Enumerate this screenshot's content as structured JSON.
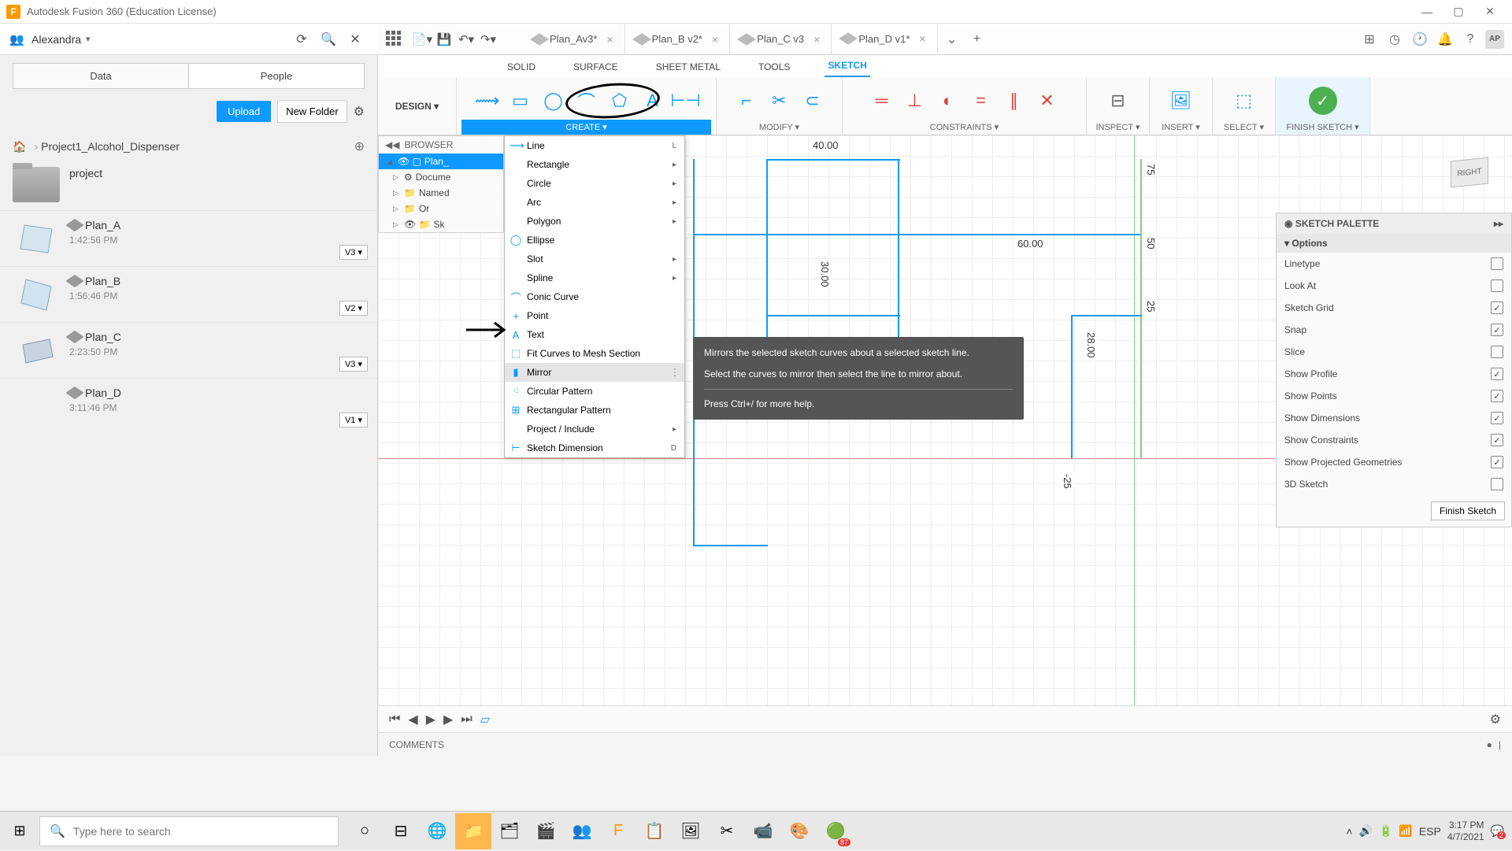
{
  "window": {
    "title": "Autodesk Fusion 360 (Education License)"
  },
  "user": {
    "name": "Alexandra",
    "avatar": "AP"
  },
  "datapanel": {
    "tabs": [
      "Data",
      "People"
    ],
    "upload": "Upload",
    "newfolder": "New Folder",
    "project": "Project1_Alcohol_Dispenser",
    "folder": "project",
    "items": [
      {
        "name": "Plan_A",
        "time": "1:42:56 PM",
        "ver": "V3 ▾"
      },
      {
        "name": "Plan_B",
        "time": "1:56:46 PM",
        "ver": "V2 ▾"
      },
      {
        "name": "Plan_C",
        "time": "2:23:50 PM",
        "ver": "V3 ▾"
      },
      {
        "name": "Plan_D",
        "time": "3:11:46 PM",
        "ver": "V1 ▾"
      }
    ]
  },
  "filetabs": [
    {
      "label": "Plan_Av3*"
    },
    {
      "label": "Plan_B v2*"
    },
    {
      "label": "Plan_C v3"
    },
    {
      "label": "Plan_D v1*"
    }
  ],
  "workspaces": {
    "items": [
      "SOLID",
      "SURFACE",
      "SHEET METAL",
      "TOOLS",
      "SKETCH"
    ],
    "active": 4
  },
  "ribbon": {
    "design": "DESIGN ▾",
    "groups": {
      "create": "CREATE ▾",
      "modify": "MODIFY ▾",
      "constraints": "CONSTRAINTS ▾",
      "inspect": "INSPECT ▾",
      "insert": "INSERT ▾",
      "select": "SELECT ▾",
      "finish": "FINISH SKETCH ▾"
    }
  },
  "browser": {
    "header": "BROWSER",
    "root": "Plan_",
    "nodes": [
      "Docume",
      "Named",
      "Or",
      "Sk"
    ]
  },
  "menu": {
    "items": [
      {
        "label": "Line",
        "shortcut": "L",
        "icon": "⟿"
      },
      {
        "label": "Rectangle",
        "sub": true
      },
      {
        "label": "Circle",
        "sub": true
      },
      {
        "label": "Arc",
        "sub": true
      },
      {
        "label": "Polygon",
        "sub": true
      },
      {
        "label": "Ellipse",
        "icon": "◯"
      },
      {
        "label": "Slot",
        "sub": true
      },
      {
        "label": "Spline",
        "sub": true
      },
      {
        "label": "Conic Curve",
        "icon": "⌒"
      },
      {
        "label": "Point",
        "icon": "+"
      },
      {
        "label": "Text",
        "icon": "A"
      },
      {
        "label": "Fit Curves to Mesh Section",
        "icon": "⬚"
      },
      {
        "label": "Mirror",
        "icon": "▮",
        "hover": true
      },
      {
        "label": "Circular Pattern",
        "icon": "⁖"
      },
      {
        "label": "Rectangular Pattern",
        "icon": "⊞"
      },
      {
        "label": "Project / Include",
        "sub": true
      },
      {
        "label": "Sketch Dimension",
        "shortcut": "D",
        "icon": "⊢"
      }
    ]
  },
  "tooltip": {
    "line1": "Mirrors the selected sketch curves about a selected sketch line.",
    "line2": "Select the curves to mirror then select the line to mirror about.",
    "line3": "Press Ctrl+/ for more help."
  },
  "dims": {
    "d1": "40.00",
    "d2": "60.00",
    "d3": "30.00",
    "d4": "28.00",
    "d5": "75",
    "d6": "50",
    "d7": "25",
    "d8": "-25"
  },
  "palette": {
    "title": "SKETCH PALETTE",
    "section": "Options",
    "rows": [
      {
        "label": "Linetype",
        "check": false
      },
      {
        "label": "Look At",
        "check": false
      },
      {
        "label": "Sketch Grid",
        "check": true
      },
      {
        "label": "Snap",
        "check": true
      },
      {
        "label": "Slice",
        "check": false
      },
      {
        "label": "Show Profile",
        "check": true
      },
      {
        "label": "Show Points",
        "check": true
      },
      {
        "label": "Show Dimensions",
        "check": true
      },
      {
        "label": "Show Constraints",
        "check": true
      },
      {
        "label": "Show Projected Geometries",
        "check": true
      },
      {
        "label": "3D Sketch",
        "check": false
      }
    ],
    "finish": "Finish Sketch"
  },
  "viewcube": {
    "face": "RIGHT"
  },
  "comments": "COMMENTS",
  "taskbar": {
    "search": "Type here to search",
    "lang": "ESP",
    "time": "3:17 PM",
    "date": "4/7/2021",
    "badge": "87",
    "notif": "2"
  }
}
